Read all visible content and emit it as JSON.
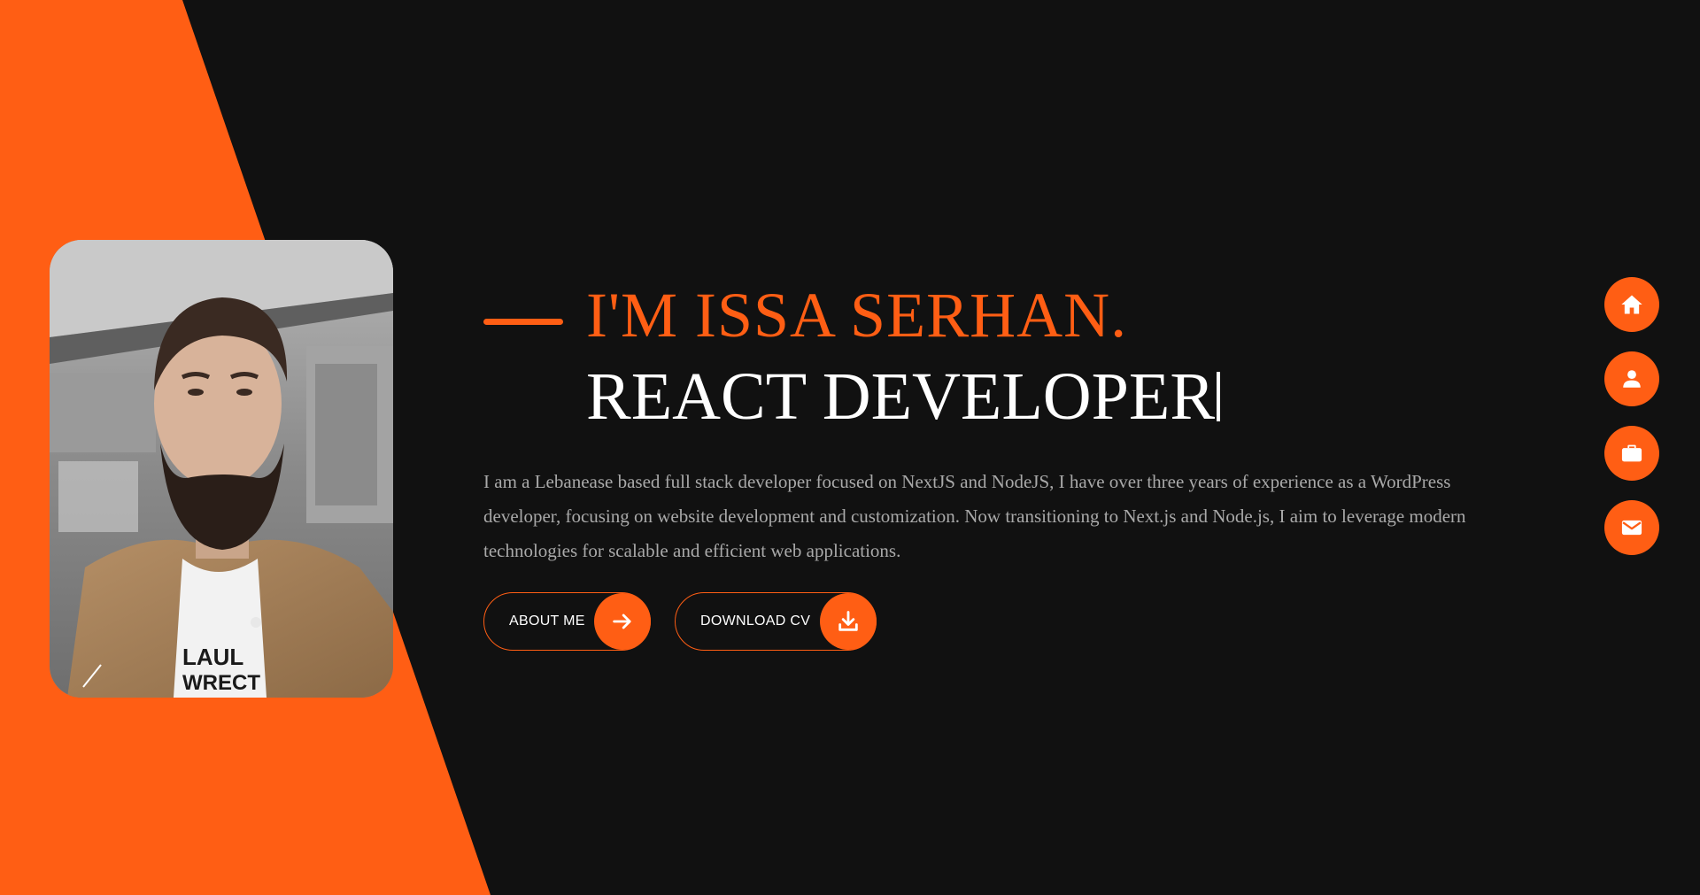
{
  "hero": {
    "name": "I'M ISSA SERHAN.",
    "role": "REACT DEVELOPER",
    "bio": "I am a Lebanease based full stack developer focused on NextJS and NodeJS, I have over three years of experience as a WordPress developer, focusing on website development and customization. Now transitioning to Next.js and Node.js, I aim to leverage modern technologies for scalable and efficient web applications."
  },
  "buttons": {
    "about_label": "ABOUT ME",
    "about_icon": "arrow-right-icon",
    "cv_label": "DOWNLOAD CV",
    "cv_icon": "download-icon"
  },
  "side_nav": [
    {
      "icon": "home-icon"
    },
    {
      "icon": "user-icon"
    },
    {
      "icon": "briefcase-icon"
    },
    {
      "icon": "mail-icon"
    }
  ],
  "colors": {
    "accent": "#ff5e14",
    "background": "#111111",
    "text": "#ffffff",
    "muted_text": "#a9a9a9"
  }
}
